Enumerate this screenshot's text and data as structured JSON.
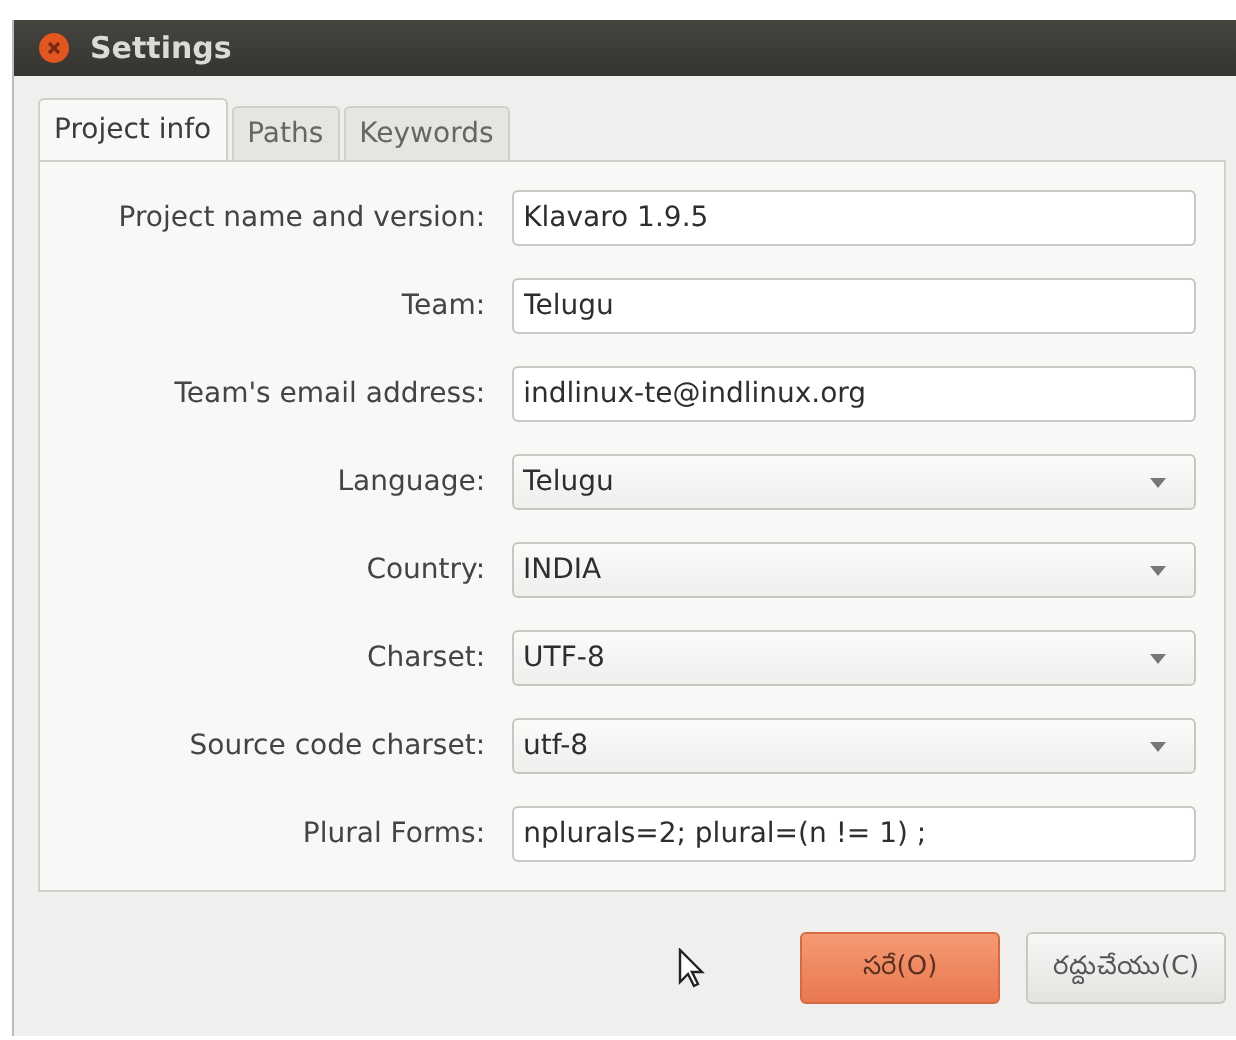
{
  "window": {
    "title": "Settings"
  },
  "tabs": [
    {
      "label": "Project info",
      "selected": true
    },
    {
      "label": "Paths",
      "selected": false
    },
    {
      "label": "Keywords",
      "selected": false
    }
  ],
  "fields": [
    {
      "kind": "text",
      "label": "Project name and version:",
      "value": "Klavaro 1.9.5"
    },
    {
      "kind": "text",
      "label": "Team:",
      "value": "Telugu"
    },
    {
      "kind": "text",
      "label": "Team's email address:",
      "value": "indlinux-te@indlinux.org"
    },
    {
      "kind": "combo",
      "label": "Language:",
      "value": "Telugu"
    },
    {
      "kind": "combo",
      "label": "Country:",
      "value": "INDIA"
    },
    {
      "kind": "combo",
      "label": "Charset:",
      "value": "UTF-8"
    },
    {
      "kind": "combo",
      "label": "Source code charset:",
      "value": "utf-8"
    },
    {
      "kind": "text",
      "label": "Plural Forms:",
      "value": "nplurals=2; plural=(n != 1) ;"
    }
  ],
  "buttons": [
    {
      "label": "సరే(O)",
      "kind": "default"
    },
    {
      "label": "రద్దుచేయు(C)",
      "kind": "normal"
    }
  ]
}
